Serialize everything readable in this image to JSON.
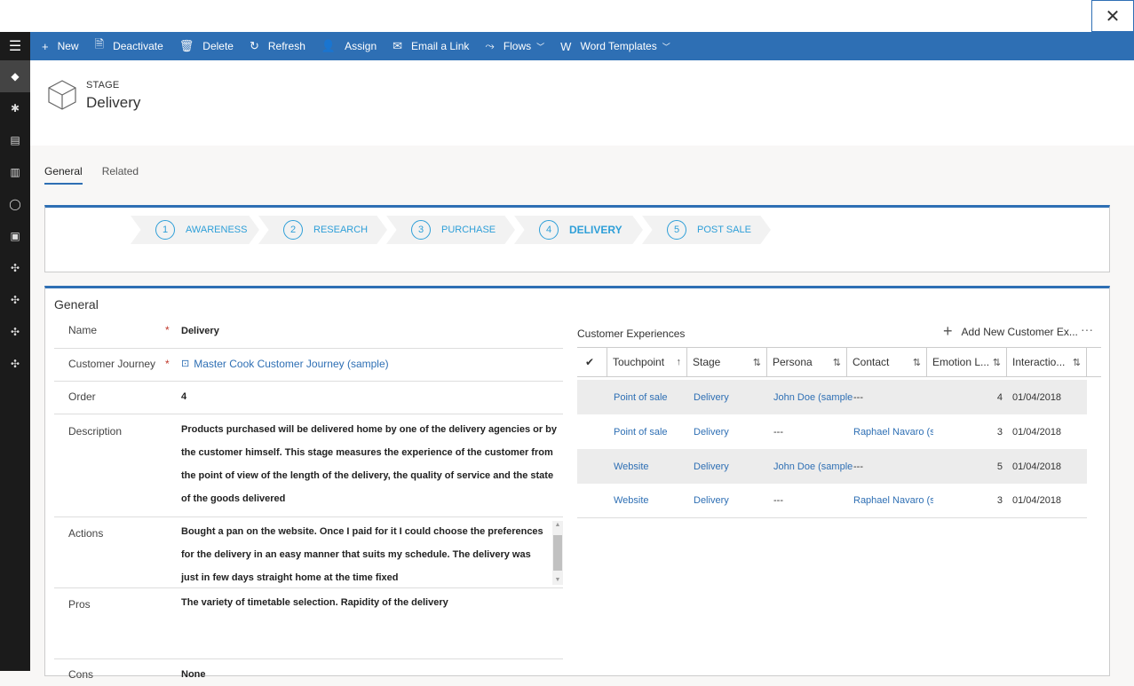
{
  "window": {
    "close_icon": "close-icon"
  },
  "commands": [
    {
      "label": "New",
      "icon": "+"
    },
    {
      "label": "Deactivate",
      "icon": "🗎"
    },
    {
      "label": "Delete",
      "icon": "🗑"
    },
    {
      "label": "Refresh",
      "icon": "↻"
    },
    {
      "label": "Assign",
      "icon": "👤"
    },
    {
      "label": "Email a Link",
      "icon": "✉"
    },
    {
      "label": "Flows",
      "icon": "⤳",
      "dropdown": true
    },
    {
      "label": "Word Templates",
      "icon": "W",
      "dropdown": true
    }
  ],
  "header": {
    "entity_type": "STAGE",
    "title": "Delivery"
  },
  "tabs": [
    {
      "label": "General",
      "active": true
    },
    {
      "label": "Related",
      "active": false
    }
  ],
  "stages": [
    {
      "num": "1",
      "label": "AWARENESS"
    },
    {
      "num": "2",
      "label": "RESEARCH"
    },
    {
      "num": "3",
      "label": "PURCHASE"
    },
    {
      "num": "4",
      "label": "DELIVERY",
      "current": true
    },
    {
      "num": "5",
      "label": "POST SALE"
    }
  ],
  "form": {
    "section_title": "General",
    "name": {
      "label": "Name",
      "value": "Delivery"
    },
    "journey": {
      "label": "Customer Journey",
      "value": "Master Cook Customer Journey (sample)"
    },
    "order": {
      "label": "Order",
      "value": "4"
    },
    "description": {
      "label": "Description",
      "value": "Products purchased will be delivered home by one of the delivery agencies or by the customer himself. This stage measures the experience of the customer from the point of view of the length of the delivery, the quality of service and the state of the goods delivered"
    },
    "actions": {
      "label": "Actions",
      "value": "Bought a pan on the website. Once I paid for it I could choose the preferences for the delivery in an easy manner that suits my schedule. The delivery was just in few days straight home at the time fixed"
    },
    "pros": {
      "label": "Pros",
      "value": "The variety of timetable selection. Rapidity of the delivery"
    },
    "cons": {
      "label": "Cons",
      "value": "None"
    }
  },
  "grid": {
    "title": "Customer Experiences",
    "add_label": "Add New Customer Ex...",
    "more": "···",
    "columns": [
      "Touchpoint",
      "Stage",
      "Persona",
      "Contact",
      "Emotion L...",
      "Interactio..."
    ],
    "rows": [
      {
        "touchpoint": "Point of sale",
        "stage": "Delivery",
        "persona": "John Doe (sample",
        "contact": "---",
        "emotion": "4",
        "interaction": "01/04/2018"
      },
      {
        "touchpoint": "Point of sale",
        "stage": "Delivery",
        "persona": "---",
        "contact": "Raphael Navaro (s",
        "emotion": "3",
        "interaction": "01/04/2018"
      },
      {
        "touchpoint": "Website",
        "stage": "Delivery",
        "persona": "John Doe (sample",
        "contact": "---",
        "emotion": "5",
        "interaction": "01/04/2018"
      },
      {
        "touchpoint": "Website",
        "stage": "Delivery",
        "persona": "---",
        "contact": "Raphael Navaro (s",
        "emotion": "3",
        "interaction": "01/04/2018"
      }
    ]
  }
}
